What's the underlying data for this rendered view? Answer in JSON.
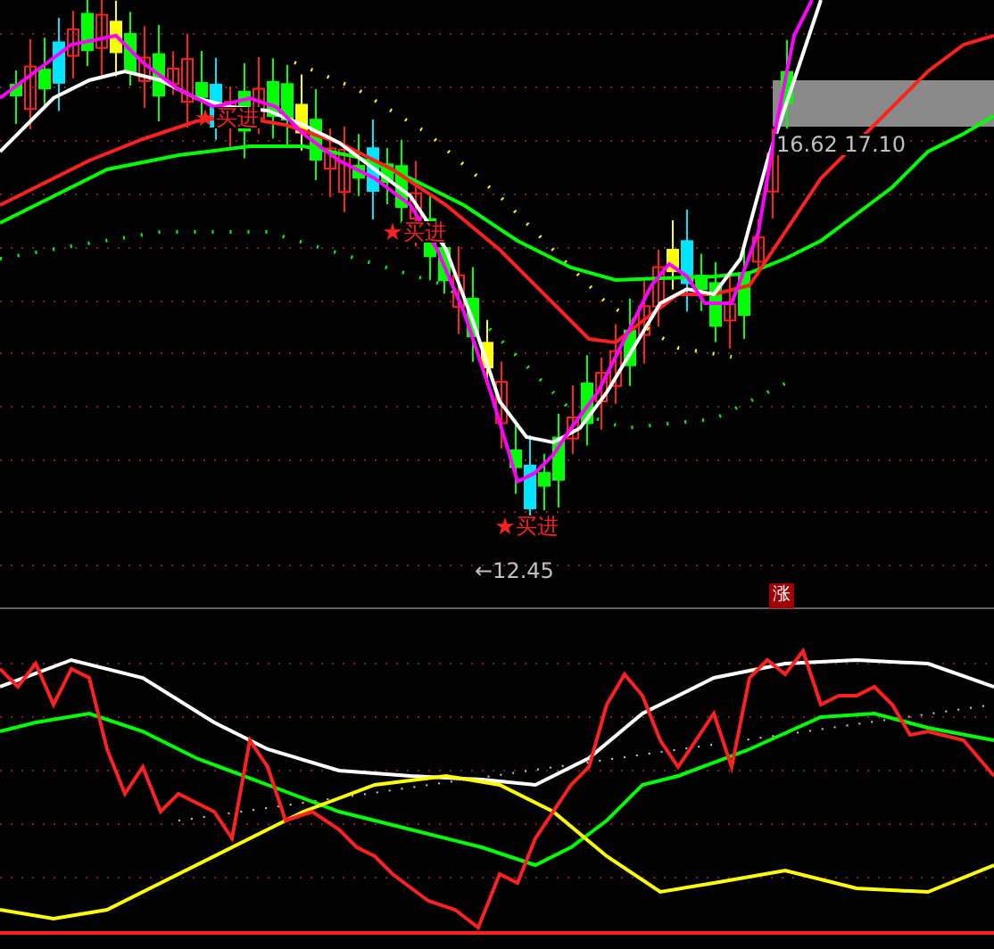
{
  "signals": [
    {
      "text": "买进"
    },
    {
      "text": "买进"
    },
    {
      "text": "买进"
    }
  ],
  "low_price_marker": "←12.45",
  "range_label": "16.62 17.10",
  "badge": "涨"
}
